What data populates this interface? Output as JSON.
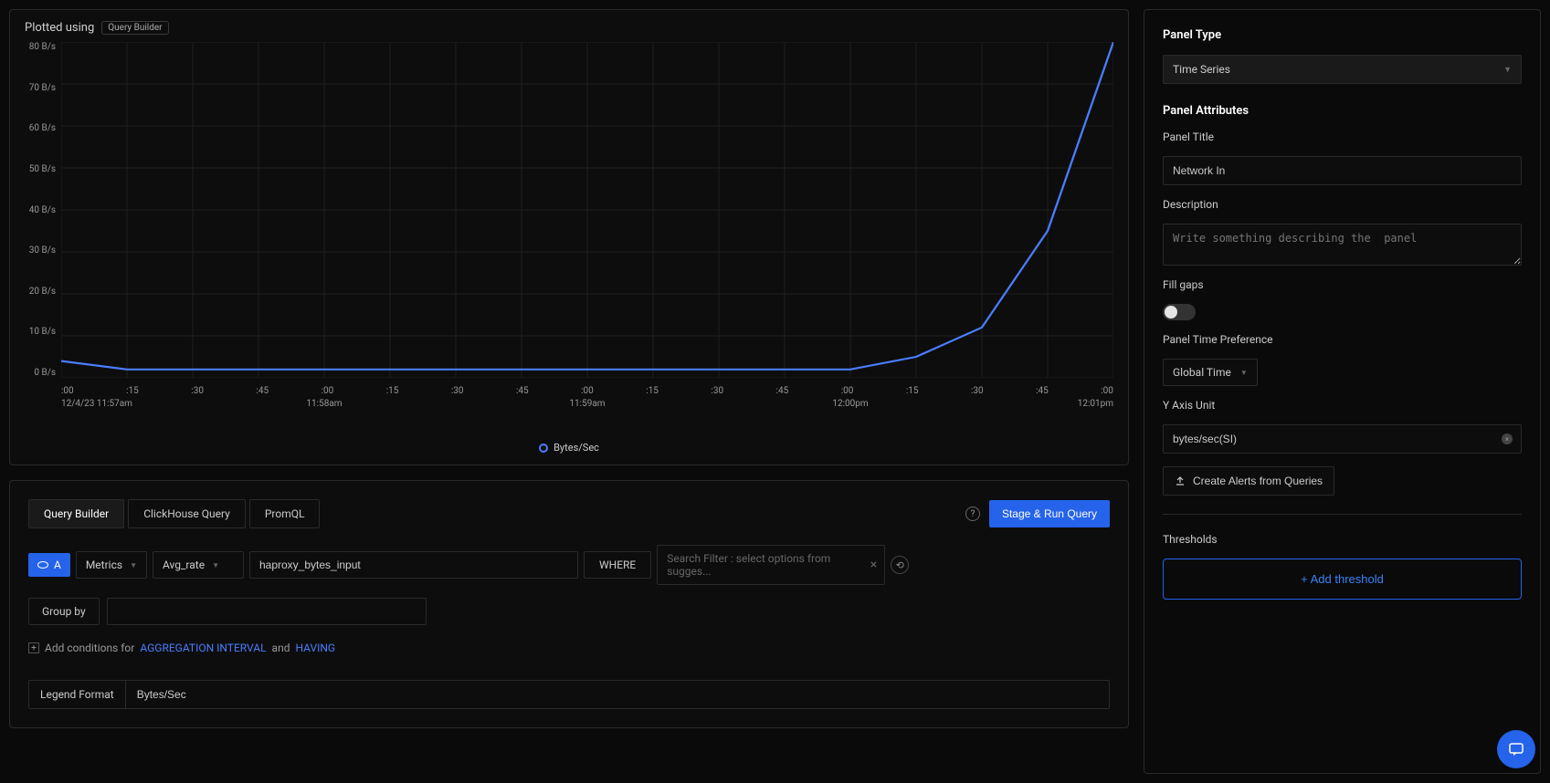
{
  "chart": {
    "plotted_using_label": "Plotted using",
    "plotted_using_badge": "Query Builder",
    "legend_label": "Bytes/Sec",
    "y_ticks": [
      "80 B/s",
      "70 B/s",
      "60 B/s",
      "50 B/s",
      "40 B/s",
      "30 B/s",
      "20 B/s",
      "10 B/s",
      "0 B/s"
    ],
    "x_minor": [
      ":00",
      ":15",
      ":30",
      ":45",
      ":00",
      ":15",
      ":30",
      ":45",
      ":00",
      ":15",
      ":30",
      ":45",
      ":00",
      ":15",
      ":30",
      ":45",
      ":00"
    ],
    "x_major": [
      {
        "label": "12/4/23 11:57am",
        "pos": 0
      },
      {
        "label": "11:58am",
        "pos": 25
      },
      {
        "label": "11:59am",
        "pos": 50
      },
      {
        "label": "12:00pm",
        "pos": 75
      },
      {
        "label": "12:01pm",
        "pos": 100
      }
    ]
  },
  "chart_data": {
    "type": "line",
    "title": "Network In",
    "xlabel": "",
    "ylabel": "",
    "ylim": [
      0,
      80
    ],
    "y_unit": "B/s",
    "x_start": "12/4/23 11:57am",
    "x_end": "12/4/23 12:01pm",
    "series": [
      {
        "name": "Bytes/Sec",
        "color": "#4a7dff",
        "x": [
          "11:57:00",
          "11:57:15",
          "11:57:30",
          "11:57:45",
          "11:58:00",
          "11:58:15",
          "11:58:30",
          "11:58:45",
          "11:59:00",
          "11:59:15",
          "11:59:30",
          "11:59:45",
          "12:00:00",
          "12:00:15",
          "12:00:30",
          "12:00:45",
          "12:01:00"
        ],
        "y": [
          4,
          2,
          2,
          2,
          2,
          2,
          2,
          2,
          2,
          2,
          2,
          2,
          2,
          5,
          12,
          35,
          80
        ]
      }
    ]
  },
  "query": {
    "tabs": [
      "Query Builder",
      "ClickHouse Query",
      "PromQL"
    ],
    "active_tab": 0,
    "run_label": "Stage & Run Query",
    "letter": "A",
    "source": "Metrics",
    "agg": "Avg_rate",
    "metric": "haproxy_bytes_input",
    "where_label": "WHERE",
    "filter_placeholder": "Search Filter : select options from sugges...",
    "groupby_label": "Group by",
    "conditions_prefix": "Add conditions for",
    "conditions_agg": "AGGREGATION INTERVAL",
    "conditions_and": "and",
    "conditions_having": "HAVING",
    "legend_format_label": "Legend Format",
    "legend_format_value": "Bytes/Sec"
  },
  "sidebar": {
    "panel_type_label": "Panel Type",
    "panel_type_value": "Time Series",
    "panel_attributes_label": "Panel Attributes",
    "panel_title_label": "Panel Title",
    "panel_title_value": "Network In",
    "description_label": "Description",
    "description_placeholder": "Write something describing the  panel",
    "fill_gaps_label": "Fill gaps",
    "fill_gaps_on": false,
    "time_pref_label": "Panel Time Preference",
    "time_pref_value": "Global Time",
    "yaxis_label": "Y Axis Unit",
    "yaxis_value": "bytes/sec(SI)",
    "alerts_label": "Create Alerts from Queries",
    "thresholds_label": "Thresholds",
    "add_threshold_label": "+ Add threshold"
  },
  "colors": {
    "primary": "#2563eb",
    "line": "#4a7dff"
  }
}
